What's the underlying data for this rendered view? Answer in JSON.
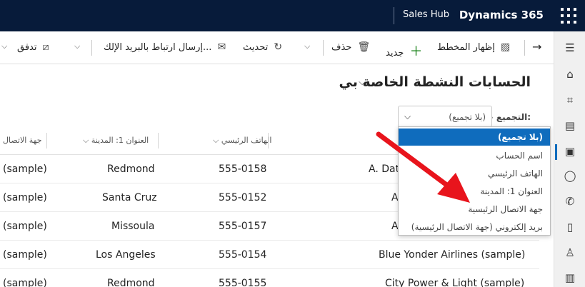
{
  "topbar": {
    "brand": "Dynamics 365",
    "app": "Sales Hub"
  },
  "rail": {
    "icons": [
      "menu-icon",
      "home-icon",
      "pin-icon",
      "clipboard-icon",
      "accounts-icon",
      "contacts-icon",
      "phone-icon",
      "notes-icon",
      "person-icon",
      "document-icon"
    ]
  },
  "commands": {
    "show_chart": "إظهار المخطط",
    "new": "جديد",
    "delete": "حذف",
    "refresh": "تحديث",
    "email_link": "إرسال ارتباط بالبريد الإلك...",
    "flow": "تدفق"
  },
  "view": {
    "title": "الحسابات النشطة الخاصة بي"
  },
  "groupby": {
    "label": "التجميع حسب:",
    "value": "(بلا تجميع)"
  },
  "columns": {
    "phone": "الهاتف الرئيسي",
    "city": "العنوان 1: المدينة",
    "contact": "جهة الاتصال"
  },
  "rows": [
    {
      "name": "A. Dat",
      "phone": "555-0158",
      "city": "Redmond",
      "contact": "(sample)"
    },
    {
      "name": "A",
      "phone": "555-0152",
      "city": "Santa Cruz",
      "contact": "(sample)"
    },
    {
      "name": "A",
      "phone": "555-0157",
      "city": "Missoula",
      "contact": "(sample)"
    },
    {
      "name": "Blue Yonder Airlines (sample)",
      "phone": "555-0154",
      "city": "Los Angeles",
      "contact": "(sample)"
    },
    {
      "name": "City Power & Light (sample)",
      "phone": "555-0155",
      "city": "Redmond",
      "contact": "(sample)"
    }
  ],
  "dropdown": {
    "options": [
      "(بلا تجميع)",
      "اسم الحساب",
      "الهاتف الرئيسي",
      "العنوان 1: المدينة",
      "جهة الاتصال الرئيسية",
      "بريد إلكتروني (جهة الاتصال الرئيسية)"
    ],
    "selected_index": 0
  },
  "colors": {
    "topbar": "#071b3a",
    "accent": "#0f6cbd",
    "annotation_arrow": "#e8141c"
  }
}
